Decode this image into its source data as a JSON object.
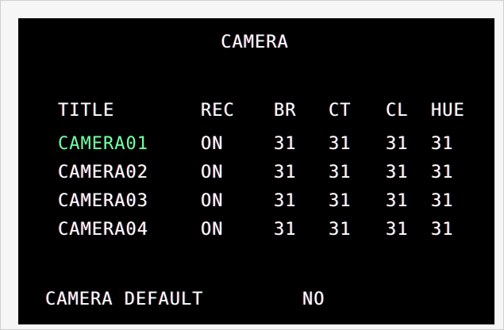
{
  "menu": {
    "title": "CAMERA",
    "headers": {
      "title": "TITLE",
      "rec": "REC",
      "br": "BR",
      "ct": "CT",
      "cl": "CL",
      "hue": "HUE"
    },
    "rows": [
      {
        "title": "CAMERA01",
        "rec": "ON",
        "br": "31",
        "ct": "31",
        "cl": "31",
        "hue": "31"
      },
      {
        "title": "CAMERA02",
        "rec": "ON",
        "br": "31",
        "ct": "31",
        "cl": "31",
        "hue": "31"
      },
      {
        "title": "CAMERA03",
        "rec": "ON",
        "br": "31",
        "ct": "31",
        "cl": "31",
        "hue": "31"
      },
      {
        "title": "CAMERA04",
        "rec": "ON",
        "br": "31",
        "ct": "31",
        "cl": "31",
        "hue": "31"
      }
    ],
    "default": {
      "label": "CAMERA DEFAULT",
      "value": "NO"
    }
  },
  "colors": {
    "background": "#000000",
    "text": "#ffffff",
    "selected_title": "#6fffa0",
    "frame": "#f6f6f6"
  }
}
